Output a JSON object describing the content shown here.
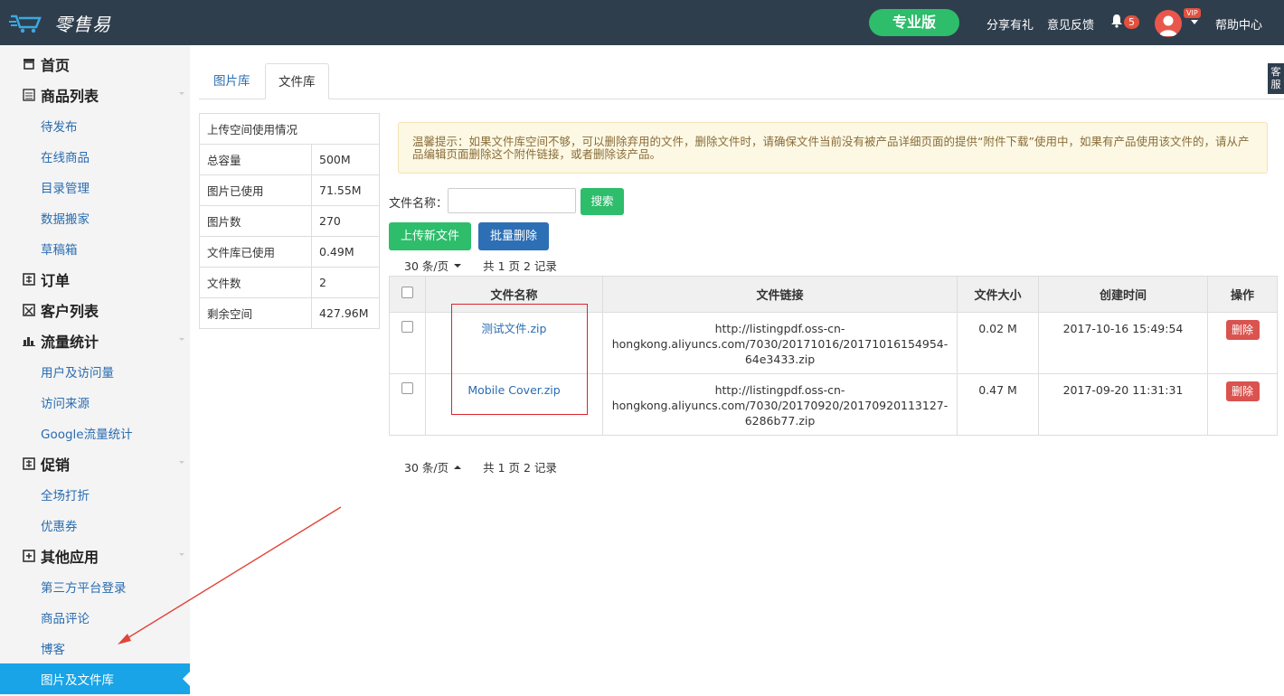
{
  "header": {
    "logo_text": "零售易",
    "pro_label": "专业版",
    "links": [
      "分享有礼",
      "意见反馈"
    ],
    "notification_count": "5",
    "vip_label": "VIP",
    "help_label": "帮助中心"
  },
  "sidebar": {
    "items": [
      {
        "label": "首页",
        "type": "group",
        "icon": "store-icon"
      },
      {
        "label": "商品列表",
        "type": "group",
        "icon": "list-icon"
      },
      {
        "label": "待发布",
        "type": "sub"
      },
      {
        "label": "在线商品",
        "type": "sub"
      },
      {
        "label": "目录管理",
        "type": "sub"
      },
      {
        "label": "数据搬家",
        "type": "sub"
      },
      {
        "label": "草稿箱",
        "type": "sub"
      },
      {
        "label": "订单",
        "type": "group",
        "icon": "order-icon"
      },
      {
        "label": "客户列表",
        "type": "group",
        "icon": "customer-icon"
      },
      {
        "label": "流量统计",
        "type": "group",
        "icon": "chart-icon"
      },
      {
        "label": "用户及访问量",
        "type": "sub"
      },
      {
        "label": "访问来源",
        "type": "sub"
      },
      {
        "label": "Google流量统计",
        "type": "sub"
      },
      {
        "label": "促销",
        "type": "group",
        "icon": "promo-icon"
      },
      {
        "label": "全场打折",
        "type": "sub"
      },
      {
        "label": "优惠券",
        "type": "sub"
      },
      {
        "label": "其他应用",
        "type": "group",
        "icon": "plus-box-icon"
      },
      {
        "label": "第三方平台登录",
        "type": "sub"
      },
      {
        "label": "商品评论",
        "type": "sub"
      },
      {
        "label": "博客",
        "type": "sub"
      },
      {
        "label": "图片及文件库",
        "type": "sub",
        "active": true
      }
    ]
  },
  "tabs": [
    "图片库",
    "文件库"
  ],
  "kefu_label": "客服",
  "usage": {
    "title": "上传空间使用情况",
    "rows": [
      [
        "总容量",
        "500M"
      ],
      [
        "图片已使用",
        "71.55M"
      ],
      [
        "图片数",
        "270"
      ],
      [
        "文件库已使用",
        "0.49M"
      ],
      [
        "文件数",
        "2"
      ],
      [
        "剩余空间",
        "427.96M"
      ]
    ]
  },
  "notice": "温馨提示：如果文件库空间不够，可以删除弃用的文件，删除文件时，请确保文件当前没有被产品详细页面的提供“附件下载”使用中，如果有产品使用该文件的，请从产品编辑页面删除这个附件链接，或者删除该产品。",
  "search": {
    "label": "文件名称：",
    "value": "",
    "button": "搜索"
  },
  "buttons": {
    "upload": "上传新文件",
    "batch_delete": "批量删除"
  },
  "pager": {
    "per_page": "30 条/页",
    "total": "共 1 页 2 记录"
  },
  "table": {
    "headers": [
      "文件名称",
      "文件链接",
      "文件大小",
      "创建时间",
      "操作"
    ],
    "rows": [
      {
        "name": "测试文件.zip",
        "link": [
          "http://listingpdf.oss-cn-",
          "hongkong.aliyuncs.com/7030/20171016/20171016154954-",
          "64e3433.zip"
        ],
        "size": "0.02 M",
        "created": "2017-10-16 15:49:54",
        "action": "删除"
      },
      {
        "name": "Mobile Cover.zip",
        "link": [
          "http://listingpdf.oss-cn-",
          "hongkong.aliyuncs.com/7030/20170920/20170920113127-",
          "6286b77.zip"
        ],
        "size": "0.47 M",
        "created": "2017-09-20 11:31:31",
        "action": "删除"
      }
    ]
  },
  "colors": {
    "topbar": "#2f3e4d",
    "green": "#2ebd6b",
    "blue": "#2d6fb5",
    "active": "#18a4e6",
    "danger": "#d9534f"
  }
}
